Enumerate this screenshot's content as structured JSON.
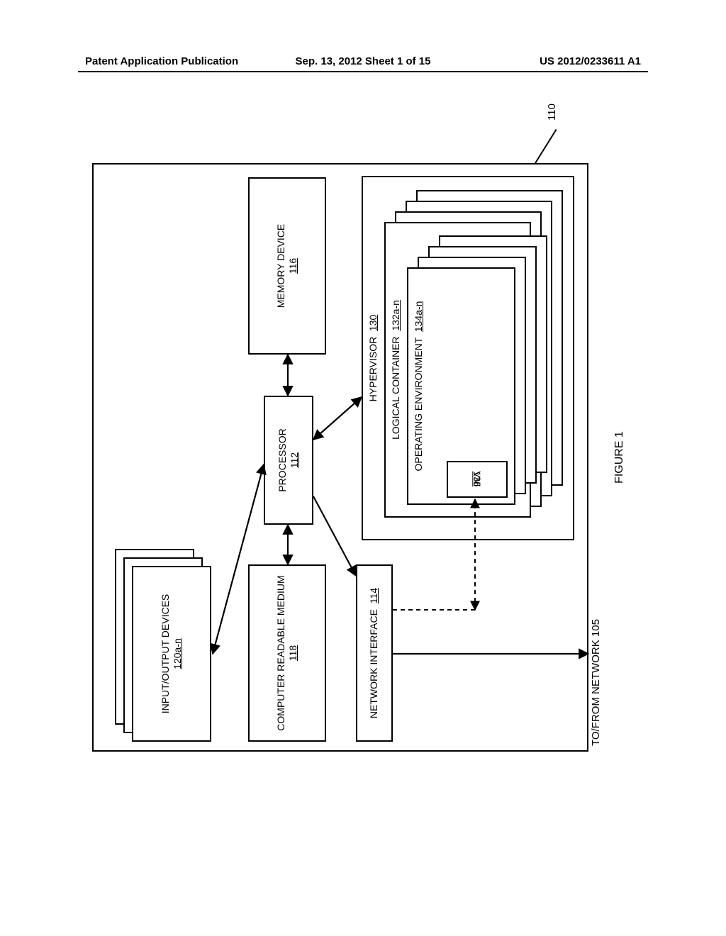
{
  "header": {
    "left": "Patent Application Publication",
    "center": "Sep. 13, 2012  Sheet 1 of 15",
    "right": "US 2012/0233611 A1"
  },
  "figure": {
    "caption": "FIGURE 1",
    "ref110": "110",
    "network_label": "TO/FROM NETWORK 105",
    "io": {
      "title": "INPUT/OUTPUT DEVICES",
      "ref": "120a-n"
    },
    "crm": {
      "title": "COMPUTER READABLE MEDIUM",
      "ref": "118"
    },
    "processor": {
      "title": "PROCESSOR",
      "ref": "112"
    },
    "memory": {
      "title": "MEMORY DEVICE",
      "ref": "116"
    },
    "ni": {
      "title": "NETWORK INTERFACE",
      "ref": "114"
    },
    "hypervisor": {
      "title": "HYPERVISOR",
      "ref": "130"
    },
    "lc": {
      "title": "LOGICAL CONTAINER",
      "ref": "132a-n"
    },
    "oe": {
      "title": "OPERATING ENVIRONMENT",
      "ref": "134a-n"
    },
    "vni": {
      "title": "VNI",
      "ref": "136"
    }
  }
}
